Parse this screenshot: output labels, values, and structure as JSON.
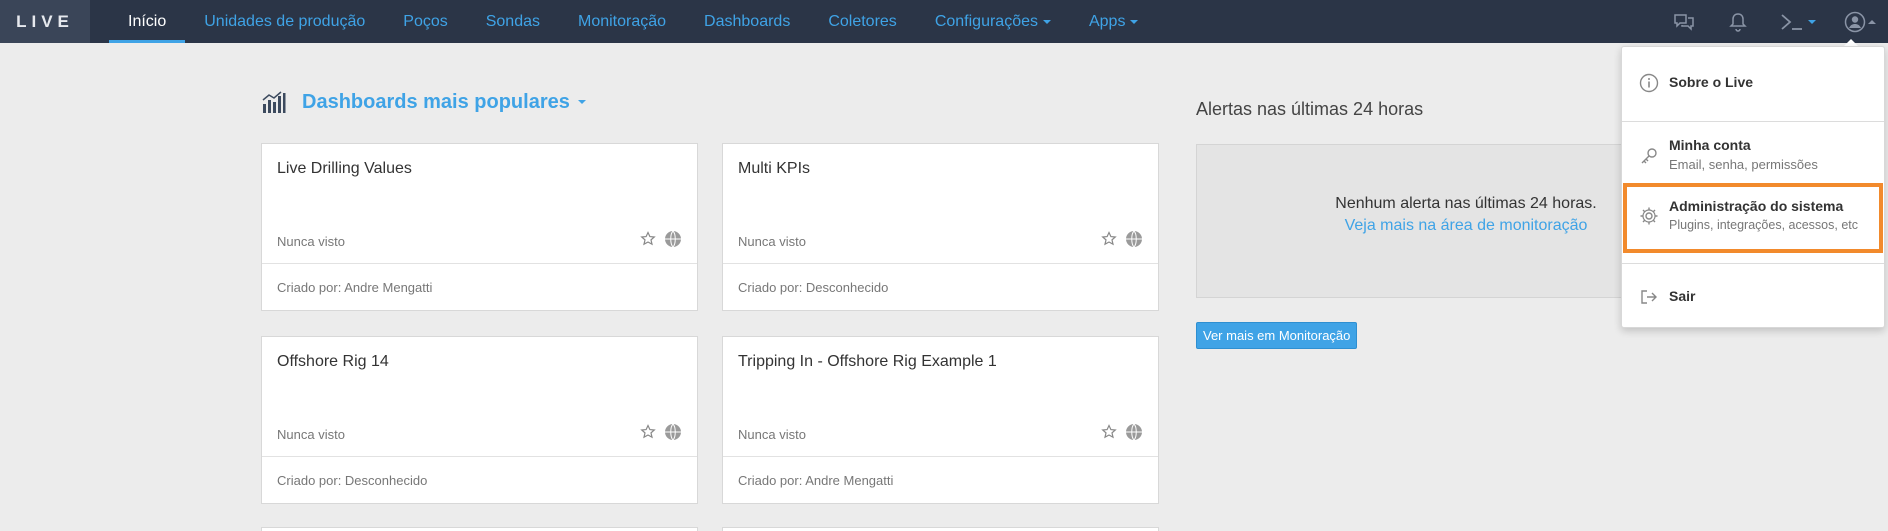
{
  "app": {
    "logo": "LIVE"
  },
  "nav": {
    "items": [
      {
        "label": "Início",
        "active": true
      },
      {
        "label": "Unidades de produção"
      },
      {
        "label": "Poços"
      },
      {
        "label": "Sondas"
      },
      {
        "label": "Monitoração"
      },
      {
        "label": "Dashboards"
      },
      {
        "label": "Coletores"
      },
      {
        "label": "Configurações",
        "dropdown": true
      },
      {
        "label": "Apps",
        "dropdown": true
      }
    ]
  },
  "top_icons": [
    "chat-icon",
    "bell-icon",
    "terminal-icon",
    "user-icon"
  ],
  "dashboards": {
    "title": "Dashboards mais populares",
    "cards": [
      {
        "title": "Live Drilling Values",
        "status": "Nunca visto",
        "footer": "Criado por: Andre Mengatti"
      },
      {
        "title": "Multi KPIs",
        "status": "Nunca visto",
        "footer": "Criado por: Desconhecido"
      },
      {
        "title": "Offshore Rig 14",
        "status": "Nunca visto",
        "footer": "Criado por: Desconhecido"
      },
      {
        "title": "Tripping In - Offshore Rig Example 1",
        "status": "Nunca visto",
        "footer": "Criado por: Andre Mengatti"
      }
    ]
  },
  "alerts": {
    "title": "Alertas nas últimas 24 horas",
    "empty_text": "Nenhum alerta nas últimas 24 horas.",
    "link_text": "Veja mais na área de monitoração",
    "button_label": "Ver mais em Monitoração"
  },
  "user_menu": {
    "about": {
      "label": "Sobre o Live"
    },
    "account": {
      "label": "Minha conta",
      "sub": "Email, senha, permissões"
    },
    "admin": {
      "label": "Administração do sistema",
      "sub": "Plugins, integrações, acessos, etc"
    },
    "logout": {
      "label": "Sair"
    }
  },
  "colors": {
    "topbar": "#2b3547",
    "accent": "#3fa3e6",
    "highlight": "#f28a2c",
    "background": "#ececec"
  }
}
